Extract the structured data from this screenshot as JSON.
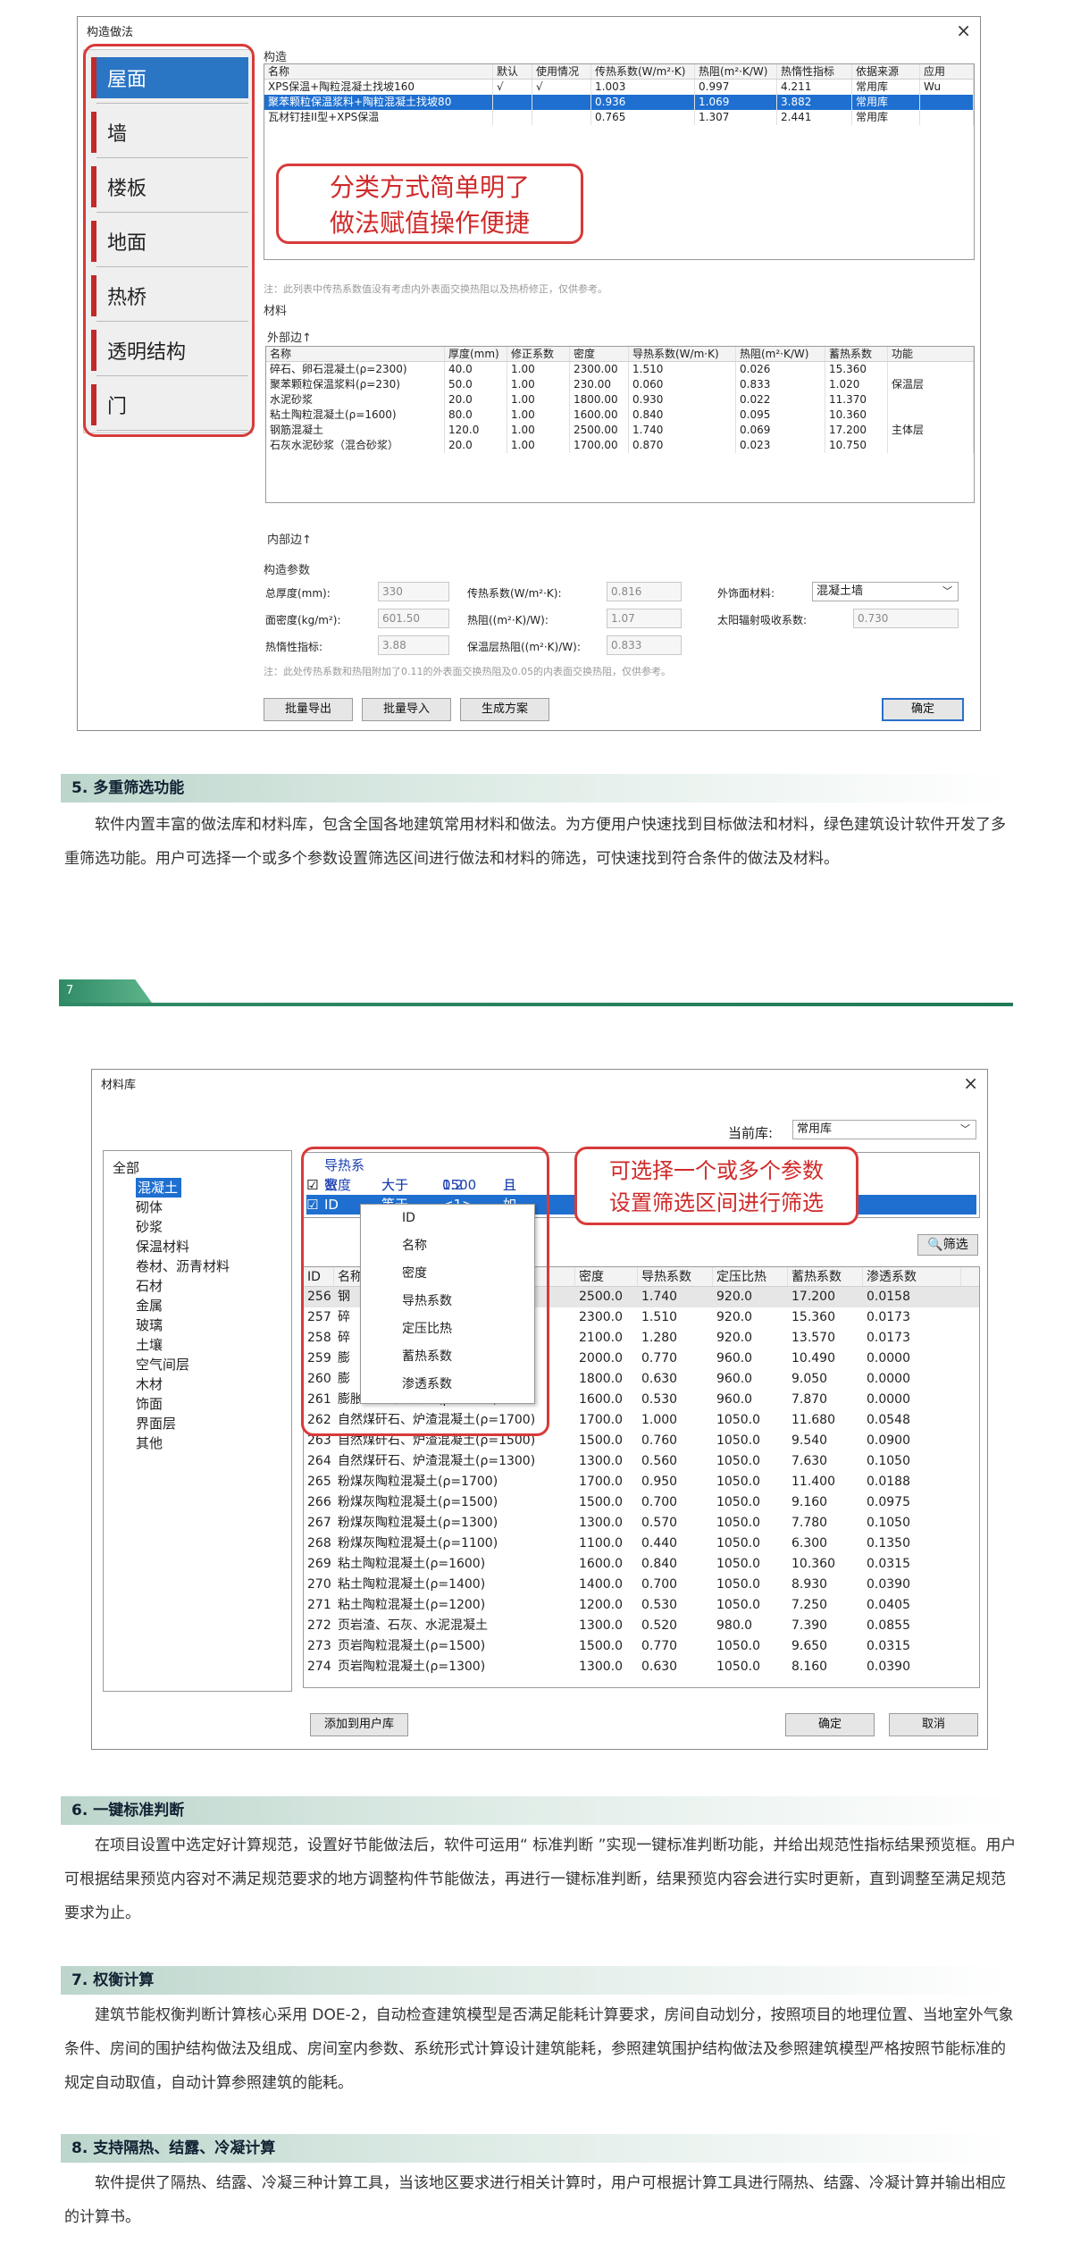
{
  "win1": {
    "title": "构造做法",
    "close": "×",
    "tabs": [
      "屋面",
      "墙",
      "楼板",
      "地面",
      "热桥",
      "透明结构",
      "门"
    ],
    "construct_label": "构造",
    "construct_headers": [
      "名称",
      "默认",
      "使用情况",
      "传热系数(W/m²·K)",
      "热阻(m²·K/W)",
      "热惰性指标",
      "依据来源",
      "应用"
    ],
    "construct_rows": [
      [
        "XPS保温+陶粒混凝土找坡160",
        "√",
        "√",
        "1.003",
        "0.997",
        "4.211",
        "常用库",
        "Wu"
      ],
      [
        "聚苯颗粒保温浆料+陶粒混凝土找坡80",
        "",
        "",
        "0.936",
        "1.069",
        "3.882",
        "常用库",
        ""
      ],
      [
        "瓦材钉挂II型+XPS保温",
        "",
        "",
        "0.765",
        "1.307",
        "2.441",
        "常用库",
        ""
      ]
    ],
    "callout": [
      "分类方式简单明了",
      "做法赋值操作便捷"
    ],
    "note1": "注：此列表中传热系数值没有考虑内外表面交换热阻以及热桥修正，仅供参考。",
    "material_label": "材料",
    "outer_label": "外部边↑",
    "mat_headers": [
      "名称",
      "厚度(mm)",
      "修正系数",
      "密度",
      "导热系数(W/m·K)",
      "热阻(m²·K/W)",
      "蓄热系数",
      "功能"
    ],
    "mat_rows": [
      [
        "碎石、卵石混凝土(ρ=2300)",
        "40.0",
        "1.00",
        "2300.00",
        "1.510",
        "0.026",
        "15.360",
        ""
      ],
      [
        "聚苯颗粒保温浆料(ρ=230)",
        "50.0",
        "1.00",
        "230.00",
        "0.060",
        "0.833",
        "1.020",
        "保温层"
      ],
      [
        "水泥砂浆",
        "20.0",
        "1.00",
        "1800.00",
        "0.930",
        "0.022",
        "11.370",
        ""
      ],
      [
        "粘土陶粒混凝土(ρ=1600)",
        "80.0",
        "1.00",
        "1600.00",
        "0.840",
        "0.095",
        "10.360",
        ""
      ],
      [
        "钢筋混凝土",
        "120.0",
        "1.00",
        "2500.00",
        "1.740",
        "0.069",
        "17.200",
        "主体层"
      ],
      [
        "石灰水泥砂浆（混合砂浆）",
        "20.0",
        "1.00",
        "1700.00",
        "0.870",
        "0.023",
        "10.750",
        ""
      ]
    ],
    "inner_label": "内部边↑",
    "params_label": "构造参数",
    "params": [
      {
        "label": "总厚度(mm):",
        "value": "330"
      },
      {
        "label": "面密度(kg/m²):",
        "value": "601.50"
      },
      {
        "label": "热惰性指标:",
        "value": "3.88"
      },
      {
        "label": "传热系数(W/m²·K):",
        "value": "0.816"
      },
      {
        "label": "热阻((m²·K)/W):",
        "value": "1.07"
      },
      {
        "label": "保温层热阻((m²·K)/W):",
        "value": "0.833"
      },
      {
        "label": "外饰面材料:",
        "value": "混凝土墙"
      },
      {
        "label": "太阳辐射吸收系数:",
        "value": "0.730"
      }
    ],
    "note2": "注：此处传热系数和热阻附加了0.11的外表面交换热阻及0.05的内表面交换热阻，仅供参考。",
    "buttons": [
      "批量导出",
      "批量导入",
      "生成方案",
      "确定"
    ]
  },
  "sec5": {
    "heading": "5. 多重筛选功能",
    "text": "软件内置丰富的做法库和材料库，包含全国各地建筑常用材料和做法。为方便用户快速找到目标做法和材料，绿色建筑设计软件开发了多重筛选功能。用户可选择一个或多个参数设置筛选区间进行做法和材料的筛选，可快速找到符合条件的做法及材料。"
  },
  "page_num": "7",
  "win2": {
    "title": "材料库",
    "close": "×",
    "lib_label": "当前库:",
    "lib_value": "常用库",
    "tree": [
      "全部",
      "混凝土",
      "砌体",
      "砂浆",
      "保温材料",
      "卷材、沥青材料",
      "石材",
      "金属",
      "玻璃",
      "土壤",
      "空气间层",
      "木材",
      "饰面",
      "界面层",
      "其他"
    ],
    "filters": [
      {
        "name": "导热系数",
        "op": "大于",
        "val": "0.2",
        "join": "且"
      },
      {
        "name": "密度",
        "op": "大于",
        "val": "1500",
        "join": "且"
      },
      {
        "name": "ID",
        "op": "等于",
        "val": "<1>",
        "join": "如"
      }
    ],
    "menu_items": [
      "ID",
      "名称",
      "密度",
      "导热系数",
      "定压比热",
      "蓄热系数",
      "渗透系数"
    ],
    "callout": [
      "可选择一个或多个参数",
      "设置筛选区间进行筛选"
    ],
    "filter_btn": "筛选",
    "headers": [
      "ID",
      "名称",
      "密度",
      "导热系数",
      "定压比热",
      "蓄热系数",
      "渗透系数"
    ],
    "rows": [
      [
        "256",
        "钢",
        "2500.0",
        "1.740",
        "920.0",
        "17.200",
        "0.0158"
      ],
      [
        "257",
        "碎",
        "2300.0",
        "1.510",
        "920.0",
        "15.360",
        "0.0173"
      ],
      [
        "258",
        "碎",
        "2100.0",
        "1.280",
        "920.0",
        "13.570",
        "0.0173"
      ],
      [
        "259",
        "膨",
        "2000.0",
        "0.770",
        "960.0",
        "10.490",
        "0.0000"
      ],
      [
        "260",
        "膨",
        "1800.0",
        "0.630",
        "960.0",
        "9.050",
        "0.0000"
      ],
      [
        "261",
        "膨胀矿渣珠混凝土(ρ=1600)",
        "1600.0",
        "0.530",
        "960.0",
        "7.870",
        "0.0000"
      ],
      [
        "262",
        "自然煤矸石、炉渣混凝土(ρ=1700)",
        "1700.0",
        "1.000",
        "1050.0",
        "11.680",
        "0.0548"
      ],
      [
        "263",
        "自然煤矸石、炉渣混凝土(ρ=1500)",
        "1500.0",
        "0.760",
        "1050.0",
        "9.540",
        "0.0900"
      ],
      [
        "264",
        "自然煤矸石、炉渣混凝土(ρ=1300)",
        "1300.0",
        "0.560",
        "1050.0",
        "7.630",
        "0.1050"
      ],
      [
        "265",
        "粉煤灰陶粒混凝土(ρ=1700)",
        "1700.0",
        "0.950",
        "1050.0",
        "11.400",
        "0.0188"
      ],
      [
        "266",
        "粉煤灰陶粒混凝土(ρ=1500)",
        "1500.0",
        "0.700",
        "1050.0",
        "9.160",
        "0.0975"
      ],
      [
        "267",
        "粉煤灰陶粒混凝土(ρ=1300)",
        "1300.0",
        "0.570",
        "1050.0",
        "7.780",
        "0.1050"
      ],
      [
        "268",
        "粉煤灰陶粒混凝土(ρ=1100)",
        "1100.0",
        "0.440",
        "1050.0",
        "6.300",
        "0.1350"
      ],
      [
        "269",
        "粘土陶粒混凝土(ρ=1600)",
        "1600.0",
        "0.840",
        "1050.0",
        "10.360",
        "0.0315"
      ],
      [
        "270",
        "粘土陶粒混凝土(ρ=1400)",
        "1400.0",
        "0.700",
        "1050.0",
        "8.930",
        "0.0390"
      ],
      [
        "271",
        "粘土陶粒混凝土(ρ=1200)",
        "1200.0",
        "0.530",
        "1050.0",
        "7.250",
        "0.0405"
      ],
      [
        "272",
        "页岩渣、石灰、水泥混凝土",
        "1300.0",
        "0.520",
        "980.0",
        "7.390",
        "0.0855"
      ],
      [
        "273",
        "页岩陶粒混凝土(ρ=1500)",
        "1500.0",
        "0.770",
        "1050.0",
        "9.650",
        "0.0315"
      ],
      [
        "274",
        "页岩陶粒混凝土(ρ=1300)",
        "1300.0",
        "0.630",
        "1050.0",
        "8.160",
        "0.0390"
      ]
    ],
    "add_btn": "添加到用户库",
    "ok_btn": "确定",
    "cancel_btn": "取消"
  },
  "sec6": {
    "heading": "6. 一键标准判断",
    "text": "在项目设置中选定好计算规范，设置好节能做法后，软件可运用“ 标准判断 ”实现一键标准判断功能，并给出规范性指标结果预览框。用户可根据结果预览内容对不满足规范要求的地方调整构件节能做法，再进行一键标准判断，结果预览内容会进行实时更新，直到调整至满足规范要求为止。"
  },
  "sec7": {
    "heading": "7. 权衡计算",
    "text": "建筑节能权衡判断计算核心采用 DOE-2，自动检查建筑模型是否满足能耗计算要求，房间自动划分，按照项目的地理位置、当地室外气象条件、房间的围护结构做法及组成、房间室内参数、系统形式计算设计建筑能耗，参照建筑围护结构做法及参照建筑模型严格按照节能标准的规定自动取值，自动计算参照建筑的能耗。"
  },
  "sec8": {
    "heading": "8. 支持隔热、结露、冷凝计算",
    "text": "软件提供了隔热、结露、冷凝三种计算工具，当该地区要求进行相关计算时，用户可根据计算工具进行隔热、结露、冷凝计算并输出相应的计算书。"
  }
}
